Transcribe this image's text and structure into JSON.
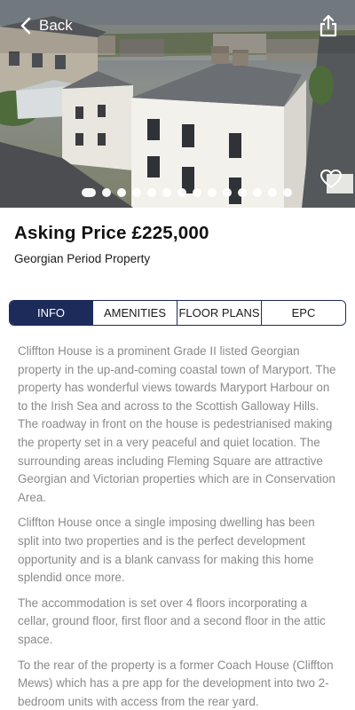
{
  "header": {
    "back_label": "Back",
    "back_icon": "chevron-left-icon",
    "share_icon": "share-icon",
    "favorite_icon": "heart-icon"
  },
  "gallery": {
    "photo_count": 14,
    "active_index": 0
  },
  "listing": {
    "price_label": "Asking Price £225,000",
    "property_type": "Georgian Period Property"
  },
  "tabs": [
    {
      "label": "INFO",
      "active": true
    },
    {
      "label": "AMENITIES",
      "active": false
    },
    {
      "label": "FLOOR PLANS",
      "active": false
    },
    {
      "label": "EPC",
      "active": false
    }
  ],
  "description": {
    "paragraphs": [
      "Cliffton House is a prominent Grade II listed Georgian property in the up-and-coming coastal town of Maryport. The property has wonderful views towards Maryport Harbour on to the Irish Sea and across to the Scottish Galloway Hills. The roadway in front on the house is pedestrianised making the property set in a very peaceful and quiet location. The surrounding areas including Fleming Square are attractive Georgian and Victorian properties which are in Conservation Area.",
      "Cliffton House once a single imposing dwelling has been split into two properties and is the perfect development opportunity and is a blank canvass for making this home splendid once more.",
      "The accommodation is set over 4 floors incorporating a cellar, ground floor, first floor and a second floor in the attic space.",
      "To the rear of the property is a former Coach House (Cliffton Mews) which has a pre app for the development into two 2-bedroom units with access from the rear yard."
    ]
  },
  "colors": {
    "accent": "#1c2b5a",
    "body_text": "#8a8a8a"
  }
}
